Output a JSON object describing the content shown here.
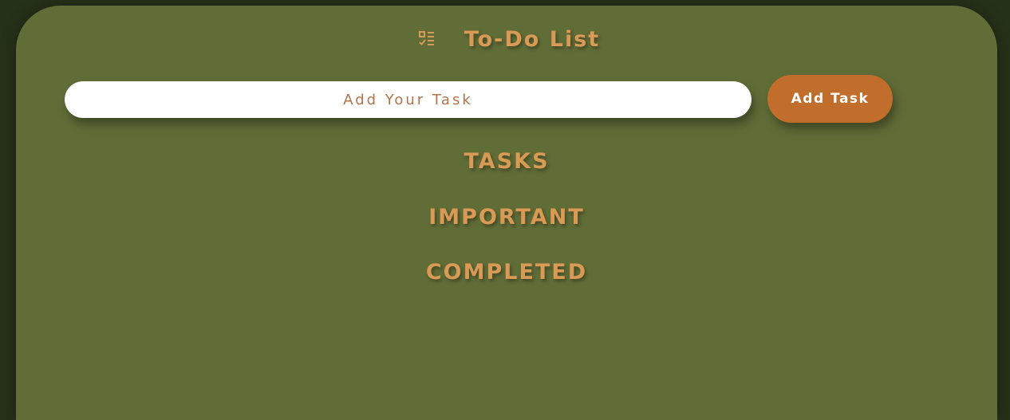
{
  "header": {
    "icon": "checklist-icon",
    "title": "To-Do List"
  },
  "task_input": {
    "placeholder": "Add Your Task",
    "value": ""
  },
  "add_button": {
    "label": "Add Task"
  },
  "sections": {
    "tasks": "TASKS",
    "important": "IMPORTANT",
    "completed": "COMPLETED"
  },
  "colors": {
    "page_background": "#263119",
    "card_background": "#616d37",
    "accent_text": "#d99a55",
    "button_background": "#c16e2c",
    "input_background": "#ffffff"
  }
}
